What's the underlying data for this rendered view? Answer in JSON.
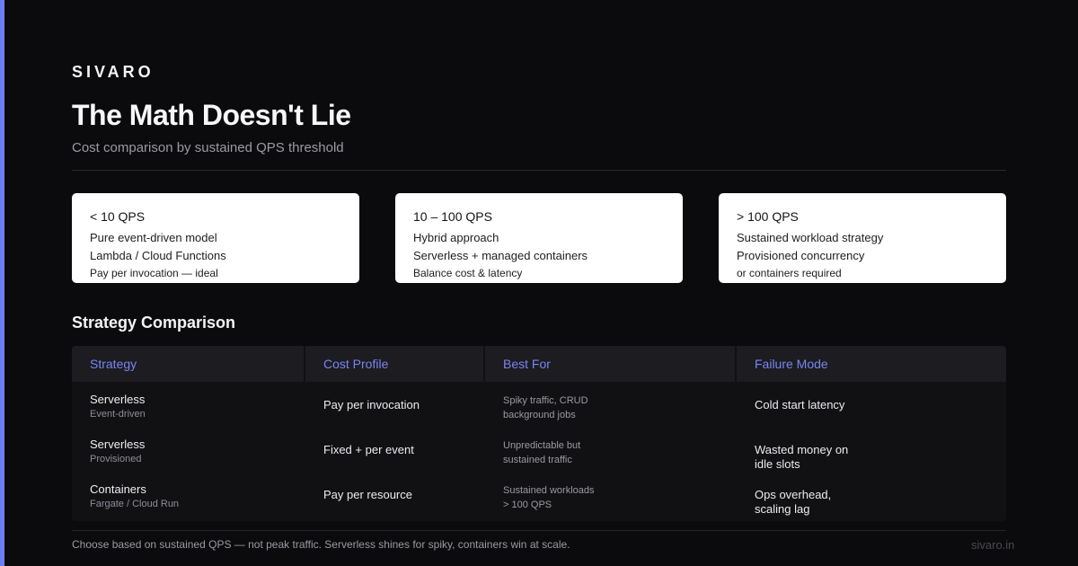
{
  "brand": "SIVARO",
  "title": "The Math Doesn't Lie",
  "subtitle": "Cost comparison by sustained QPS threshold",
  "colors": {
    "accent": "#6c7ff2",
    "background": "#0b0b0d",
    "card": "#ffffff",
    "header_text": "#7b86ee"
  },
  "cards": [
    {
      "heading": "< 10 QPS",
      "line1": "Pure event-driven model",
      "line2": "Lambda / Cloud Functions",
      "line3": "Pay per invocation — ideal"
    },
    {
      "heading": "10 – 100 QPS",
      "line1": "Hybrid approach",
      "line2": "Serverless + managed containers",
      "line3": "Balance cost & latency"
    },
    {
      "heading": "> 100 QPS",
      "line1": "Sustained workload strategy",
      "line2": "Provisioned concurrency",
      "line3": "or containers required"
    }
  ],
  "section_title": "Strategy Comparison",
  "table": {
    "headers": [
      "Strategy",
      "Cost Profile",
      "Best For",
      "Failure Mode"
    ],
    "rows": [
      {
        "strategy": "Serverless",
        "strategy_sub": "Event-driven",
        "cost": "Pay per invocation",
        "best_for_1": "Spiky traffic, CRUD",
        "best_for_2": "background jobs",
        "failure_1": "Cold start latency",
        "failure_2": ""
      },
      {
        "strategy": "Serverless",
        "strategy_sub": "Provisioned",
        "cost": "Fixed + per event",
        "best_for_1": "Unpredictable but",
        "best_for_2": "sustained traffic",
        "failure_1": "Wasted money on",
        "failure_2": "idle slots"
      },
      {
        "strategy": "Containers",
        "strategy_sub": "Fargate / Cloud Run",
        "cost": "Pay per resource",
        "best_for_1": "Sustained workloads",
        "best_for_2": "> 100 QPS",
        "failure_1": "Ops overhead,",
        "failure_2": "scaling lag"
      }
    ]
  },
  "footer": {
    "note": "Choose based on sustained QPS — not peak traffic. Serverless shines for spiky, containers win at scale.",
    "url": "sivaro.in"
  }
}
